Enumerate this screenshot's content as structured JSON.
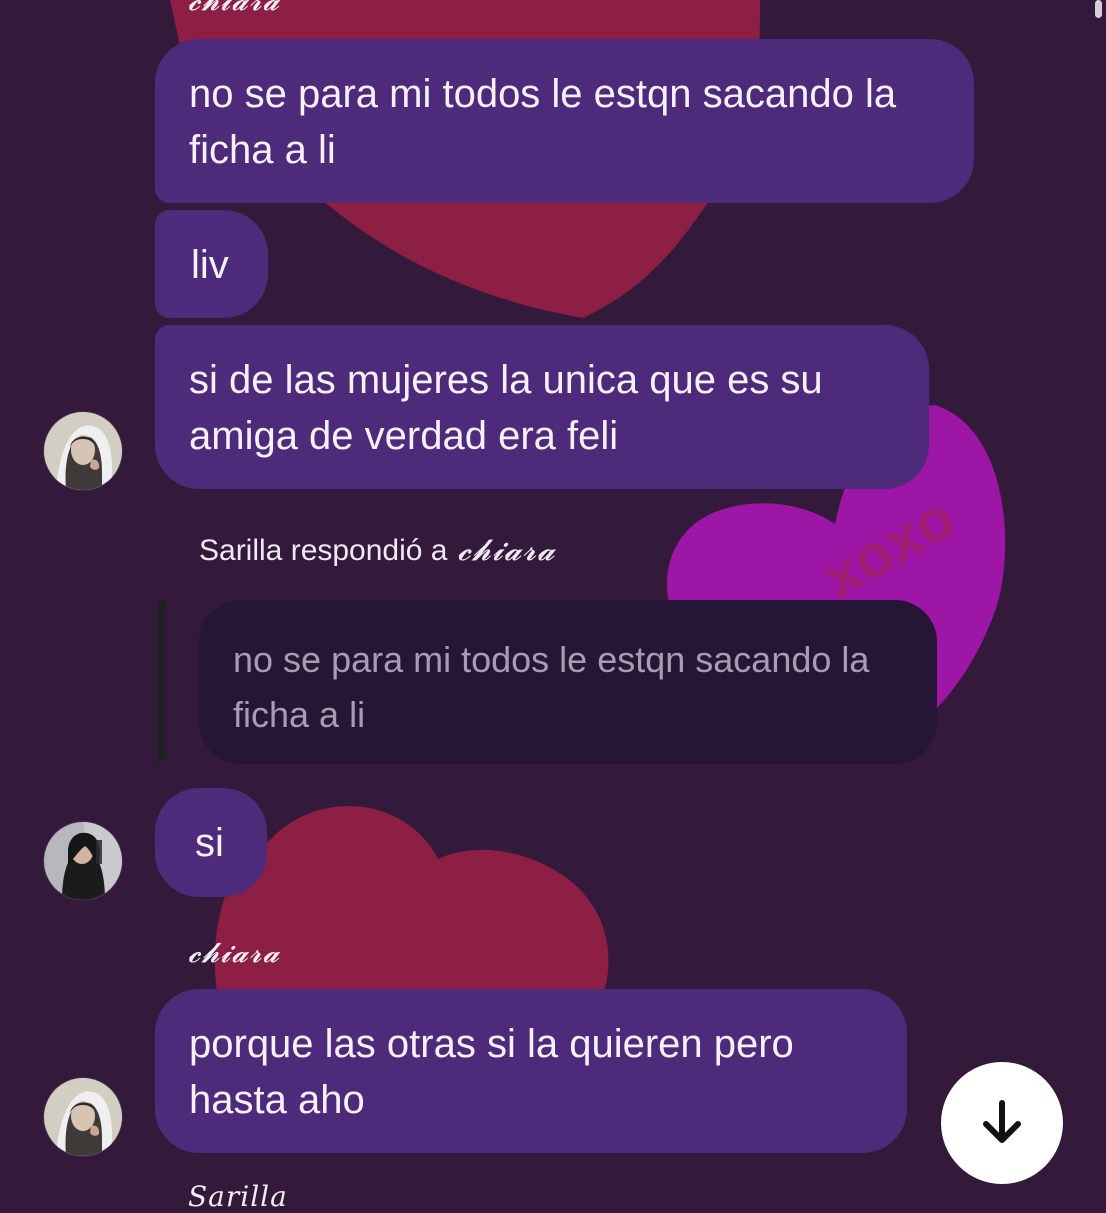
{
  "chat": {
    "top_sender_partial": "𝓬𝓱𝓲𝓪𝓻𝓪",
    "messages": [
      {
        "text": "no se para mi todos le estqn sacando la ficha a li"
      },
      {
        "text": "liv"
      },
      {
        "text": "si de las mujeres la unica que es su amiga de verdad era feli"
      }
    ],
    "reply": {
      "meta_prefix": "Sarilla respondió a",
      "meta_name": "𝓬𝓱𝓲𝓪𝓻𝓪",
      "quoted_text": "no se para mi todos le estqn sacando la ficha a li",
      "reply_text": "si"
    },
    "second_sender": "𝓬𝓱𝓲𝓪𝓻𝓪",
    "last_message": {
      "text": "porque las otras si la quieren pero hasta aho"
    },
    "bottom_sender_partial": "Sarilla"
  },
  "ui": {
    "scroll_down_icon": "arrow-down-icon"
  },
  "colors": {
    "background": "#33193a",
    "bubble": "#4d2a7a",
    "quoted_bubble": "#251636",
    "heart_red": "#8f1d3f",
    "heart_magenta": "#9f14a8"
  },
  "background": {
    "heart_text": "xoxo"
  }
}
